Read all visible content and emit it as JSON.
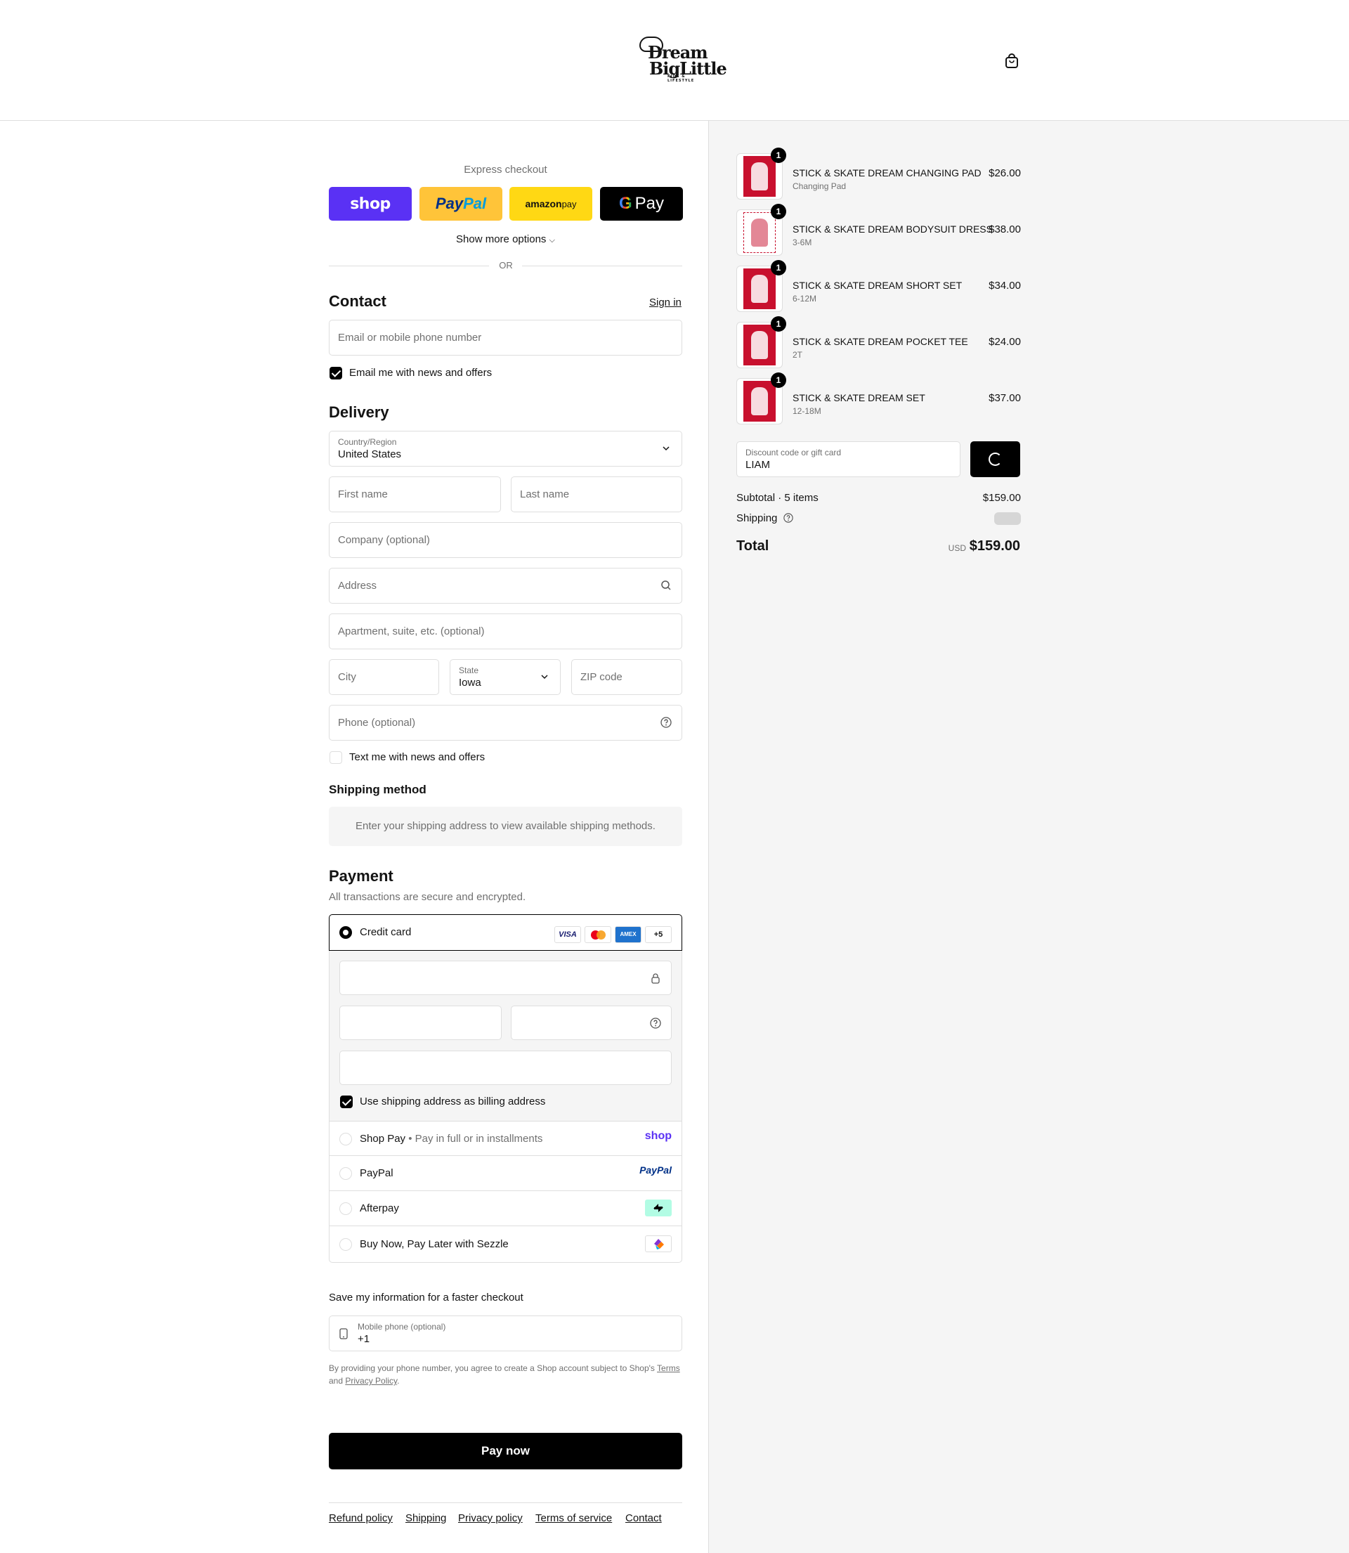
{
  "header": {
    "logo_line1": "Dream",
    "logo_line2": "BigLittle",
    "logo_tagline": "KIDS & LIFESTYLE"
  },
  "express": {
    "title": "Express checkout",
    "shop_label": "shop",
    "paypal_label_a": "Pay",
    "paypal_label_b": "Pal",
    "amazon_label_a": "amazon",
    "amazon_label_b": " pay",
    "gpay_label_g": "G",
    "gpay_label": "Pay",
    "show_more": "Show more options",
    "or": "OR"
  },
  "contact": {
    "heading": "Contact",
    "sign_in": "Sign in",
    "email_placeholder": "Email or mobile phone number",
    "newsletter_label": "Email me with news and offers",
    "newsletter_checked": true
  },
  "delivery": {
    "heading": "Delivery",
    "country_label": "Country/Region",
    "country_value": "United States",
    "first_name": "First name",
    "last_name": "Last name",
    "company": "Company (optional)",
    "address": "Address",
    "apartment": "Apartment, suite, etc. (optional)",
    "city": "City",
    "state_label": "State",
    "state_value": "Iowa",
    "zip": "ZIP code",
    "phone": "Phone (optional)",
    "sms_label": "Text me with news and offers",
    "sms_checked": false
  },
  "shipping_method": {
    "heading": "Shipping method",
    "note": "Enter your shipping address to view available shipping methods."
  },
  "payment": {
    "heading": "Payment",
    "subtitle": "All transactions are secure and encrypted.",
    "credit_card_label": "Credit card",
    "card_badges": [
      "VISA",
      "MC",
      "AMEX",
      "+5"
    ],
    "billing_label": "Use shipping address as billing address",
    "billing_checked": true,
    "methods": [
      {
        "label": "Shop Pay",
        "sub": " • Pay in full or in installments",
        "logo": "shop"
      },
      {
        "label": "PayPal",
        "sub": "",
        "logo": "PayPal"
      },
      {
        "label": "Afterpay",
        "sub": "",
        "logo": "afterpay"
      },
      {
        "label": "Buy Now, Pay Later with Sezzle",
        "sub": "",
        "logo": "sezzle"
      }
    ]
  },
  "save_info": {
    "title": "Save my information for a faster checkout",
    "phone_label": "Mobile phone (optional)",
    "phone_value": "+1",
    "legal_a": "By providing your phone number, you agree to create a Shop account subject to Shop's ",
    "legal_terms": "Terms",
    "legal_and": " and ",
    "legal_privacy": "Privacy Policy",
    "legal_end": "."
  },
  "pay_now": "Pay now",
  "footer_links": [
    "Refund policy",
    "Shipping",
    "Privacy policy",
    "Terms of service",
    "Contact"
  ],
  "cart": {
    "items": [
      {
        "name": "STICK & SKATE DREAM CHANGING PAD",
        "variant": "Changing Pad",
        "price": "$26.00",
        "qty": "1"
      },
      {
        "name": "STICK & SKATE DREAM BODYSUIT DRESS",
        "variant": "3-6M",
        "price": "$38.00",
        "qty": "1"
      },
      {
        "name": "STICK & SKATE DREAM SHORT SET",
        "variant": "6-12M",
        "price": "$34.00",
        "qty": "1"
      },
      {
        "name": "STICK & SKATE DREAM POCKET TEE",
        "variant": "2T",
        "price": "$24.00",
        "qty": "1"
      },
      {
        "name": "STICK & SKATE DREAM SET",
        "variant": "12-18M",
        "price": "$37.00",
        "qty": "1"
      }
    ],
    "discount_label": "Discount code or gift card",
    "discount_value": "LIAM",
    "subtotal_label": "Subtotal · 5 items",
    "subtotal_value": "$159.00",
    "shipping_label": "Shipping",
    "total_label": "Total",
    "total_currency": "USD",
    "total_value": "$159.00"
  },
  "colors": {
    "shop_purple": "#5a31f4",
    "paypal_yellow": "#ffc439",
    "amazon_yellow": "#ffd814",
    "accent": "#000000"
  }
}
